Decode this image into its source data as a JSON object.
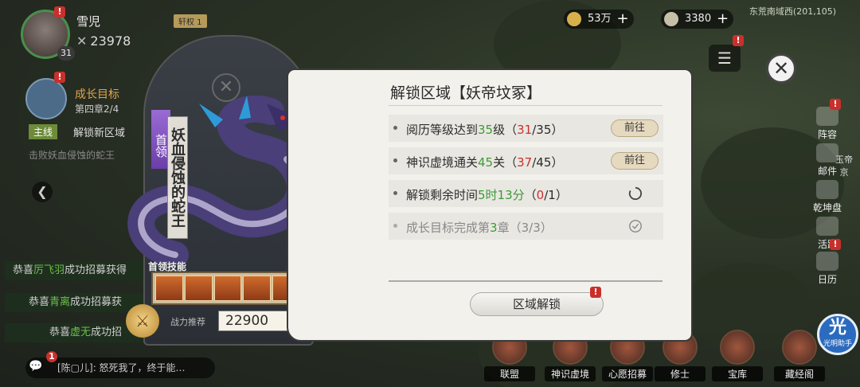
{
  "player": {
    "name": "雪児",
    "level": "31",
    "power": "23978",
    "rank_tag": "轩权 1"
  },
  "resources": [
    {
      "value": "53万"
    },
    {
      "value": "3380"
    }
  ],
  "map": {
    "location": "东荒南域西(201,105)"
  },
  "quest": {
    "goal_title": "成长目标",
    "goal_sub": "第四章2/4",
    "mainline_tag": "主线",
    "mainline_text": "解锁新区域",
    "mainline_sub": "击败妖血侵蚀的蛇王"
  },
  "feed": [
    {
      "prefix": "恭喜",
      "name": "厉飞羽",
      "suffix": "成功招募获得"
    },
    {
      "prefix": "恭喜",
      "name": "青离",
      "suffix": "成功招募获"
    },
    {
      "prefix": "恭喜",
      "name": "虚无",
      "suffix": "成功招"
    }
  ],
  "chat": {
    "badge": "1",
    "text": "[陈▢儿]: 怒死我了，终于能…"
  },
  "sidebar": [
    "阵容",
    "邮件",
    "乾坤盘",
    "活跃",
    "日历"
  ],
  "sidebar_extra": {
    "mail_label": "玉帝",
    "mail_sub": "京"
  },
  "bottom_bar": [
    "联盟",
    "神识虚境",
    "心愿招募",
    "修士",
    "宝库",
    "藏经阁"
  ],
  "helper": {
    "main": "光",
    "sub": "光明助手"
  },
  "boss": {
    "tag": "首领",
    "name": "妖血侵蚀的蛇王",
    "skill_label": "首领技能",
    "recommend_label": "战力推荐",
    "recommend_value": "22900"
  },
  "panel": {
    "title": "解锁区域【妖帝坟冢】",
    "conditions": [
      {
        "pre": "阅历等级达到",
        "num": "35",
        "post": "级",
        "prog_open": "（",
        "prog_cur": "31",
        "prog_total": "/35）",
        "action": "前往"
      },
      {
        "pre": "神识虚境通关",
        "num": "45",
        "post": "关",
        "prog_open": "（",
        "prog_cur": "37",
        "prog_total": "/45）",
        "action": "前往"
      },
      {
        "pre": "解锁剩余时间",
        "num": "5时13分",
        "post": "",
        "prog_open": "（",
        "prog_cur": "0",
        "prog_total": "/1）",
        "status": "in-progress"
      },
      {
        "pre": "成长目标完成第",
        "num": "3",
        "post": "章",
        "prog_open": "（",
        "prog_cur": "3/3",
        "prog_total": "）",
        "status": "complete"
      }
    ],
    "unlock_button": "区域解锁",
    "badge": "!"
  },
  "colors": {
    "green": "#3d9a35",
    "red": "#c9302c",
    "accent_purple": "#7a4bbf"
  },
  "icons": {
    "close": "close-icon",
    "menu": "menu-icon",
    "loading": "loading-circle-icon",
    "check": "check-circle-icon"
  }
}
